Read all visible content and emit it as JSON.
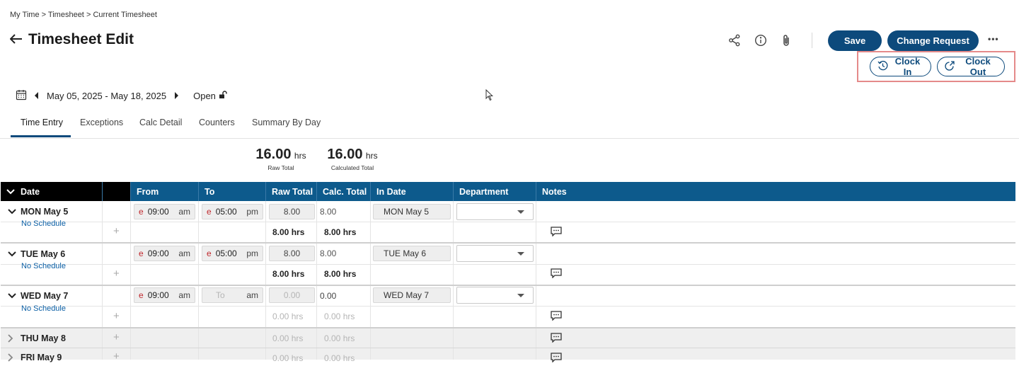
{
  "breadcrumb": {
    "items": [
      "My Time",
      "Timesheet",
      "Current Timesheet"
    ],
    "sep": ">"
  },
  "header": {
    "title": "Timesheet Edit"
  },
  "toolbar": {
    "save": "Save",
    "change_request": "Change Request",
    "more": "•••",
    "clock_in": "Clock In",
    "clock_out": "Clock Out"
  },
  "period": {
    "range": "May 05, 2025 - May 18, 2025",
    "status": "Open"
  },
  "tabs": [
    "Time Entry",
    "Exceptions",
    "Calc Detail",
    "Counters",
    "Summary By Day"
  ],
  "totals": {
    "raw": {
      "value": "16.00",
      "unit": "hrs",
      "label": "Raw Total"
    },
    "calc": {
      "value": "16.00",
      "unit": "hrs",
      "label": "Calculated Total"
    }
  },
  "columns": [
    "Date",
    "From",
    "To",
    "Raw Total",
    "Calc. Total",
    "In Date",
    "Department",
    "Notes"
  ],
  "no_schedule": "No Schedule",
  "days": [
    {
      "name": "MON May 5",
      "from": "09:00",
      "from_ampm": "am",
      "from_flag": "e",
      "to": "05:00",
      "to_ampm": "pm",
      "to_flag": "e",
      "raw": "8.00",
      "calc": "8.00",
      "in_date": "MON May 5",
      "raw_sum": "8.00 hrs",
      "calc_sum": "8.00 hrs"
    },
    {
      "name": "TUE May 6",
      "from": "09:00",
      "from_ampm": "am",
      "from_flag": "e",
      "to": "05:00",
      "to_ampm": "pm",
      "to_flag": "e",
      "raw": "8.00",
      "calc": "8.00",
      "in_date": "TUE May 6",
      "raw_sum": "8.00 hrs",
      "calc_sum": "8.00 hrs"
    },
    {
      "name": "WED May 7",
      "from": "09:00",
      "from_ampm": "am",
      "from_flag": "e",
      "to_placeholder": "To",
      "to_ampm": "am",
      "raw": "0.00",
      "calc": "0.00",
      "in_date": "WED May 7",
      "raw_sum": "0.00 hrs",
      "calc_sum": "0.00 hrs"
    },
    {
      "name": "THU May 8",
      "raw_sum": "0.00 hrs",
      "calc_sum": "0.00 hrs"
    },
    {
      "name": "FRI May 9",
      "raw_sum": "0.00 hrs",
      "calc_sum": "0.00 hrs"
    }
  ],
  "colors": {
    "primary": "#0d4a7c",
    "header": "#0d5a8c",
    "highlight": "#e58a8a",
    "flag": "#c0282d",
    "link": "#0b5fa5"
  },
  "icons": [
    "back-arrow-icon",
    "share-icon",
    "info-icon",
    "paperclip-icon",
    "calendar-icon",
    "chevron-left-icon",
    "chevron-right-icon",
    "unlock-icon",
    "clock-in-icon",
    "clock-out-icon",
    "chevron-down-icon",
    "chevron-right-icon",
    "plus-icon",
    "comment-icon",
    "dropdown-caret-icon"
  ]
}
